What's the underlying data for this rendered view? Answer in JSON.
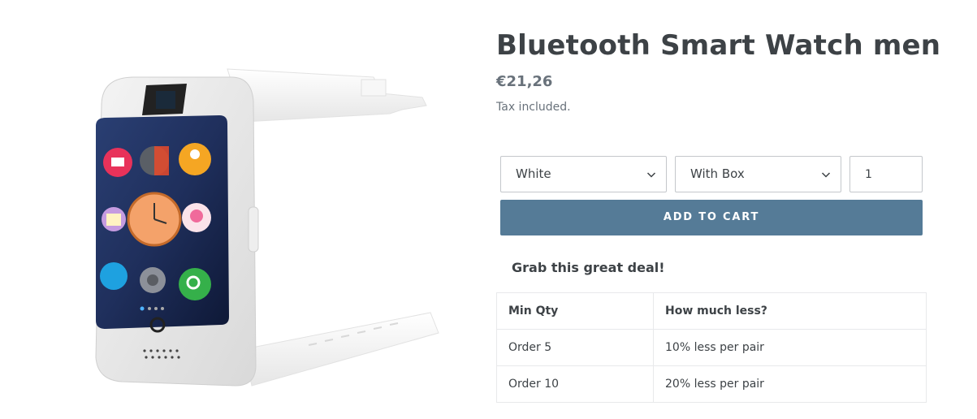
{
  "product": {
    "title": "Bluetooth Smart Watch men",
    "price": "€21,26",
    "tax_note": "Tax included."
  },
  "options": {
    "color": {
      "selected": "White"
    },
    "packaging": {
      "selected": "With Box"
    },
    "quantity": "1"
  },
  "cart": {
    "button_label": "ADD TO CART"
  },
  "deal": {
    "heading": "Grab this great deal!",
    "columns": [
      "Min Qty",
      "How much less?"
    ],
    "rows": [
      [
        "Order 5",
        "10% less per pair"
      ],
      [
        "Order 10",
        "20% less per pair"
      ]
    ]
  },
  "colors": {
    "button": "#557b97",
    "text": "#3d4246",
    "muted": "#69727b"
  }
}
